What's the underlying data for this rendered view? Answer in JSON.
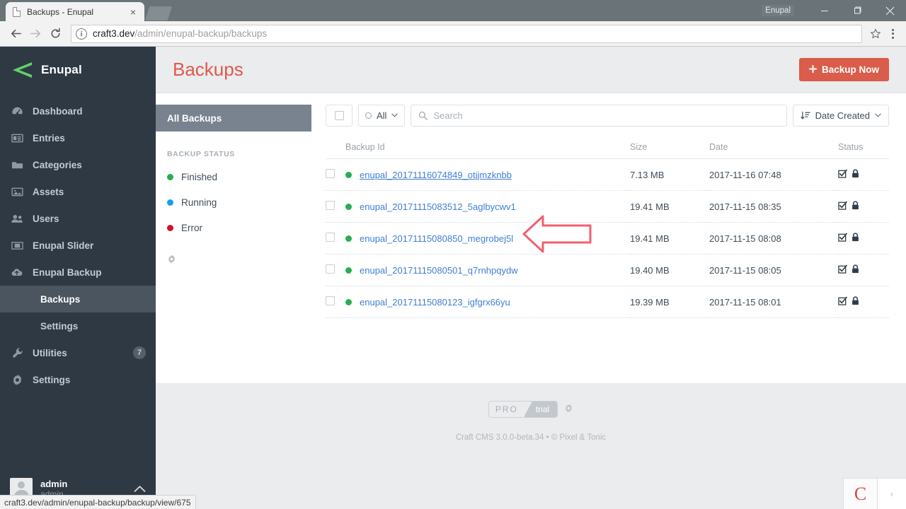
{
  "browser": {
    "tab_title": "Backups - Enupal",
    "close_label": "×",
    "profile_name": "Enupal",
    "url_host": "craft3.dev",
    "url_path": "/admin/enupal-backup/backups",
    "status_bar_url": "craft3.dev/admin/enupal-backup/backup/view/675",
    "icons": {
      "favicon": "page-icon",
      "back": "back-arrow-icon",
      "forward": "forward-arrow-icon",
      "reload": "reload-icon",
      "info": "site-info-icon",
      "star": "bookmark-star-icon",
      "menu": "chrome-menu-icon",
      "minimize": "minimize-icon",
      "maximize": "maximize-icon",
      "close": "window-close-icon"
    }
  },
  "sidebar": {
    "brand": "Enupal",
    "items": [
      {
        "label": "Dashboard",
        "icon": "gauge-icon"
      },
      {
        "label": "Entries",
        "icon": "list-card-icon"
      },
      {
        "label": "Categories",
        "icon": "folder-icon"
      },
      {
        "label": "Assets",
        "icon": "image-icon"
      },
      {
        "label": "Users",
        "icon": "users-icon"
      },
      {
        "label": "Enupal Slider",
        "icon": "slider-icon"
      },
      {
        "label": "Enupal Backup",
        "icon": "cloud-upload-icon"
      }
    ],
    "sub_items": [
      {
        "label": "Backups",
        "active": true
      },
      {
        "label": "Settings",
        "active": false
      }
    ],
    "utilities": {
      "label": "Utilities",
      "badge": "7",
      "icon": "wrench-icon"
    },
    "settings": {
      "label": "Settings",
      "icon": "gear-icon"
    },
    "user": {
      "name": "admin",
      "handle": "admin",
      "caret": "⌃"
    }
  },
  "header": {
    "title": "Backups",
    "backup_now_label": "Backup Now",
    "backup_now_plus": "➕"
  },
  "subnav": {
    "all_backups": "All Backups",
    "status_heading": "BACKUP STATUS",
    "statuses": [
      {
        "label": "Finished",
        "color": "#27ae51"
      },
      {
        "label": "Running",
        "color": "#199fe8"
      },
      {
        "label": "Error",
        "color": "#cf1226"
      }
    ],
    "gear_icon": "gear-icon"
  },
  "toolbar": {
    "select_all_label": "",
    "filter_label": "All",
    "search_placeholder": "Search",
    "search_value": "",
    "sort_label": "Date Created",
    "caret": "⌄"
  },
  "table": {
    "columns": [
      "Backup Id",
      "Size",
      "Date",
      "Status"
    ],
    "rows": [
      {
        "id": "enupal_20171116074849_otjjmzknbb",
        "size": "7.13 MB",
        "date": "2017-11-16 07:48",
        "status_color": "#27ae51",
        "highlighted": true
      },
      {
        "id": "enupal_20171115083512_5aglbycwv1",
        "size": "19.41 MB",
        "date": "2017-11-15 08:35",
        "status_color": "#27ae51",
        "highlighted": false
      },
      {
        "id": "enupal_20171115080850_megrobej5l",
        "size": "19.41 MB",
        "date": "2017-11-15 08:08",
        "status_color": "#27ae51",
        "highlighted": false
      },
      {
        "id": "enupal_20171115080501_q7rnhpqydw",
        "size": "19.40 MB",
        "date": "2017-11-15 08:05",
        "status_color": "#27ae51",
        "highlighted": false
      },
      {
        "id": "enupal_20171115080123_igfgrx66yu",
        "size": "19.39 MB",
        "date": "2017-11-15 08:01",
        "status_color": "#27ae51",
        "highlighted": false
      }
    ]
  },
  "footer": {
    "edition_left": "PRO",
    "edition_right": "trial",
    "gear_icon": "gear-icon",
    "copyright": "Craft CMS 3.0.0-beta.34  •  © Pixel & Tonic"
  },
  "help_widget": {
    "logo": "C",
    "chevron": "‹"
  },
  "annotation": {
    "type": "left-arrow",
    "color": "#f1616e"
  },
  "colors": {
    "accent_red": "#da5c4a",
    "title_red": "#e2584d",
    "sidebar_bg": "#2f3944",
    "link_blue": "#3f7fd4"
  }
}
